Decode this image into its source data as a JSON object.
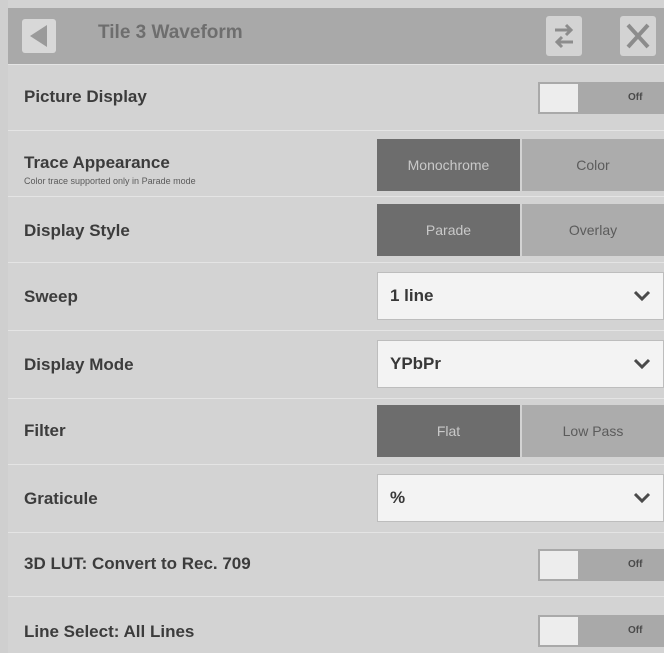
{
  "header": {
    "title": "Tile 3 Waveform"
  },
  "rows": {
    "picture_display": {
      "label": "Picture Display",
      "state": "Off"
    },
    "trace_appearance": {
      "label": "Trace Appearance",
      "note": "Color trace supported only in Parade mode",
      "options": [
        "Monochrome",
        "Color"
      ],
      "selected": "Monochrome"
    },
    "display_style": {
      "label": "Display Style",
      "options": [
        "Parade",
        "Overlay"
      ],
      "selected": "Parade"
    },
    "sweep": {
      "label": "Sweep",
      "value": "1 line"
    },
    "display_mode": {
      "label": "Display Mode",
      "value": "YPbPr"
    },
    "filter": {
      "label": "Filter",
      "options": [
        "Flat",
        "Low Pass"
      ],
      "selected": "Flat"
    },
    "graticule": {
      "label": "Graticule",
      "value": "%"
    },
    "lut": {
      "label": "3D LUT: Convert to Rec. 709",
      "state": "Off"
    },
    "line_select": {
      "label": "Line Select: All Lines",
      "state": "Off"
    }
  },
  "icons": {
    "back": "back-triangle-icon",
    "swap": "swap-arrows-icon",
    "close": "close-x-icon",
    "dropdown": "chevron-down-icon"
  },
  "colors": {
    "panel": "#d3d3d3",
    "header": "#a9a9a9",
    "segment_selected": "#6d6d6d",
    "segment_unselected": "#acacac",
    "dropdown_bg": "#f3f3f3"
  }
}
